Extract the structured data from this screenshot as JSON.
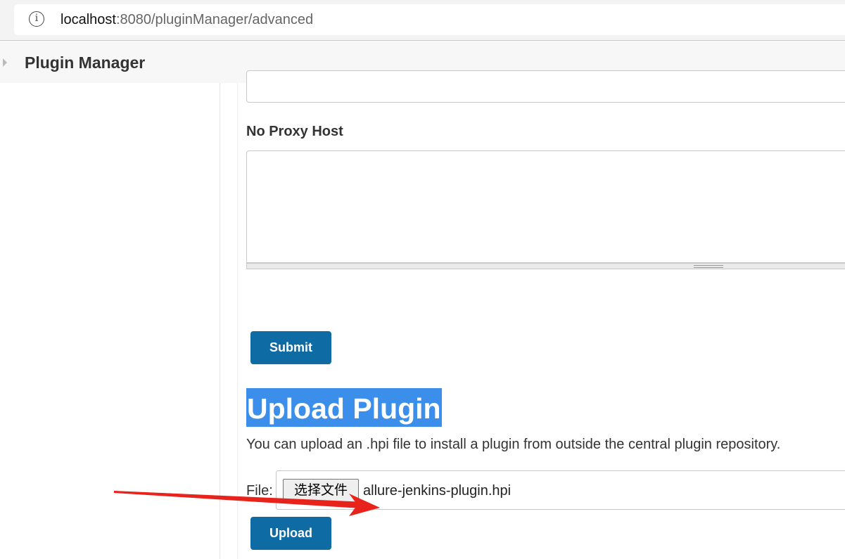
{
  "browser": {
    "url_host": "localhost",
    "url_rest": ":8080/pluginManager/advanced"
  },
  "breadcrumb": {
    "title": "Plugin Manager"
  },
  "proxy": {
    "no_proxy_label": "No Proxy Host",
    "no_proxy_value": "",
    "submit_label": "Submit"
  },
  "upload": {
    "title": "Upload Plugin",
    "description": "You can upload an .hpi file to install a plugin from outside the central plugin repository.",
    "file_label": "File:",
    "choose_button_label": "选择文件",
    "selected_file": "allure-jenkins-plugin.hpi",
    "upload_label": "Upload"
  },
  "colors": {
    "button": "#0e6ba3",
    "title_highlight": "#3b8eea",
    "annotation_arrow": "#e8231c"
  },
  "icons": {
    "address_bar": "info-icon",
    "breadcrumb": "caret-right-icon"
  }
}
